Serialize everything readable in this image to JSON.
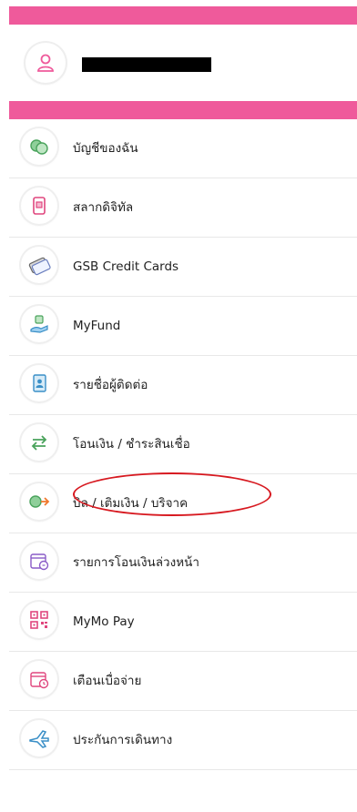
{
  "header": {
    "user_icon": "user-icon",
    "accent_color": "#ef5a9b"
  },
  "menu": {
    "items": [
      {
        "label": "บัญชีของฉัน",
        "icon": "account-icon"
      },
      {
        "label": "สลากดิจิทัล",
        "icon": "lottery-icon"
      },
      {
        "label": "GSB Credit Cards",
        "icon": "credit-card-icon"
      },
      {
        "label": "MyFund",
        "icon": "fund-icon"
      },
      {
        "label": "รายชื่อผู้ติดต่อ",
        "icon": "contacts-icon"
      },
      {
        "label": "โอนเงิน / ชำระสินเชื่อ",
        "icon": "transfer-icon"
      },
      {
        "label": "บิล / เติมเงิน / บริจาค",
        "icon": "bill-payment-icon",
        "highlighted": true
      },
      {
        "label": "รายการโอนเงินล่วงหน้า",
        "icon": "scheduled-transfer-icon"
      },
      {
        "label": "MyMo Pay",
        "icon": "qr-code-icon"
      },
      {
        "label": "เตือนเบื่อจ่าย",
        "icon": "payment-reminder-icon"
      },
      {
        "label": "ประกันการเดินทาง",
        "icon": "travel-insurance-icon"
      }
    ]
  },
  "highlight_color": "#d71920"
}
